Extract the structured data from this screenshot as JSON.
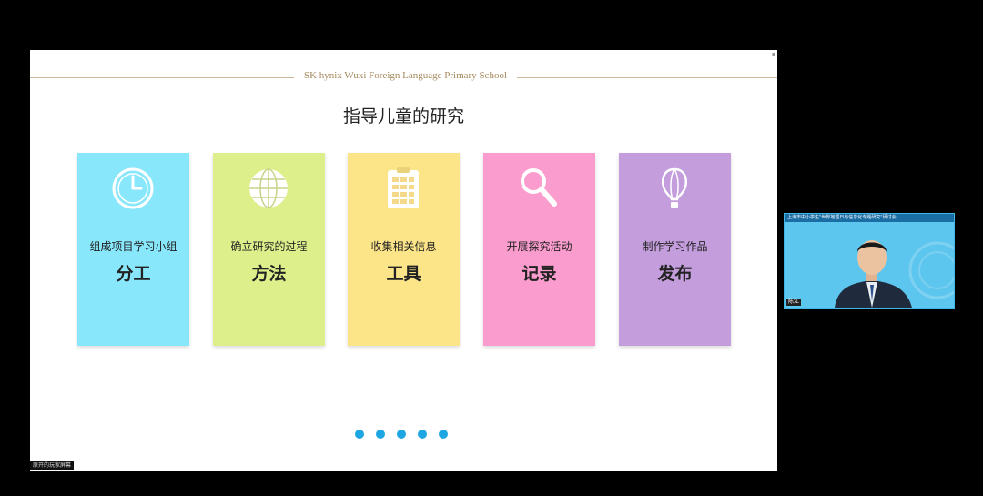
{
  "slide": {
    "header_text": "SK hynix Wuxi Foreign Language Primary School",
    "title": "指导儿童的研究"
  },
  "cards": [
    {
      "subtitle": "组成项目学习小组",
      "label": "分工",
      "icon": "clock-icon",
      "color": "#88e7fb"
    },
    {
      "subtitle": "确立研究的过程",
      "label": "方法",
      "icon": "globe-icon",
      "color": "#dcef8a"
    },
    {
      "subtitle": "收集相关信息",
      "label": "工具",
      "icon": "clipboard-icon",
      "color": "#fce589"
    },
    {
      "subtitle": "开展探究活动",
      "label": "记录",
      "icon": "magnifier-icon",
      "color": "#fa9ccd"
    },
    {
      "subtitle": "制作学习作品",
      "label": "发布",
      "icon": "balloon-icon",
      "color": "#c49ddd"
    }
  ],
  "pagination": {
    "count": 5,
    "color": "#1ea6e2"
  },
  "bottom_caption": "原开的玩家屏幕",
  "video": {
    "banner": "上海市中小学生\"世界地理日与信息化专题研究\"研讨会",
    "name": "陈江"
  }
}
